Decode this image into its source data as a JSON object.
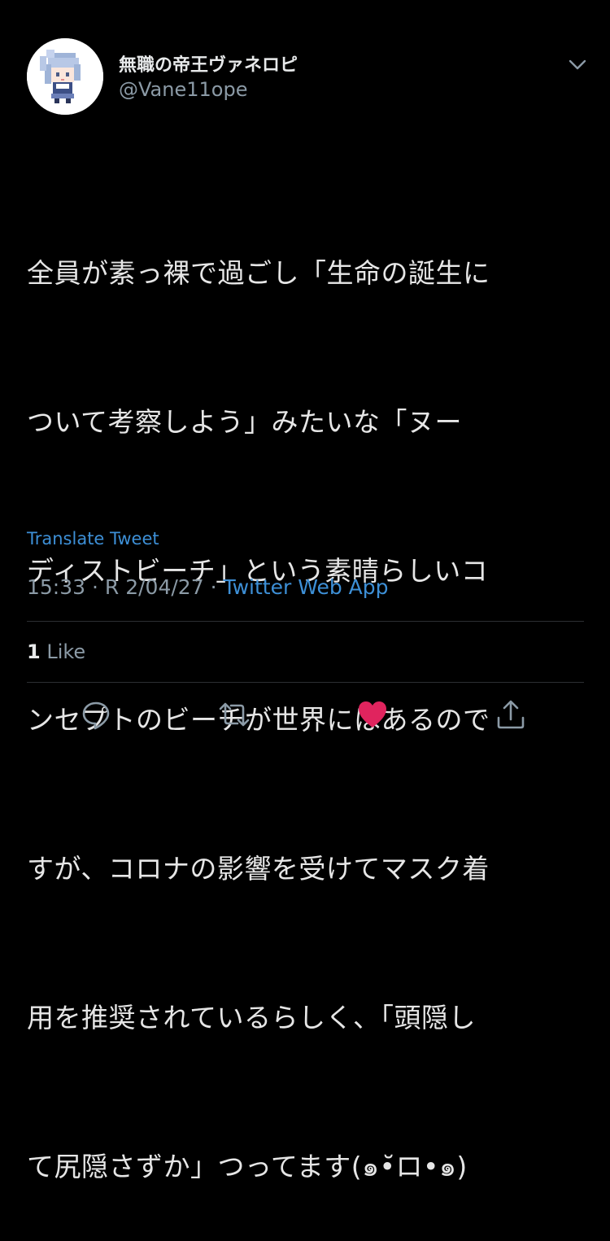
{
  "tweet": {
    "display_name": "無職の帝王ヴァネロピ",
    "handle": "@Vane11ope",
    "body_lines": [
      "全員が素っ裸で過ごし「生命の誕生に",
      "ついて考察しよう」みたいな「ヌー",
      "ディストビーチ」という素晴らしいコ",
      "ンセプトのビーチが世界にはあるので",
      "すが、コロナの影響を受けてマスク着",
      "用を推奨されているらしく、「頭隠し",
      "て尻隠さずか」つってます(๑•̆ロ•๑)"
    ],
    "translate_label": "Translate Tweet",
    "time": "15:33",
    "separator": "·",
    "date": "R 2/04/27",
    "source": "Twitter Web App",
    "like_count": "1",
    "like_label": "Like"
  },
  "icons": {
    "avatar": "pixel-art-avatar",
    "more": "chevron-down-icon",
    "reply": "reply-icon",
    "retweet": "retweet-icon",
    "like": "heart-icon",
    "share": "share-icon"
  },
  "colors": {
    "background": "#000000",
    "link": "#3d8fd6",
    "secondary_text": "#8b9aa6",
    "like_active": "#e0245e",
    "divider": "#2c2f33"
  }
}
